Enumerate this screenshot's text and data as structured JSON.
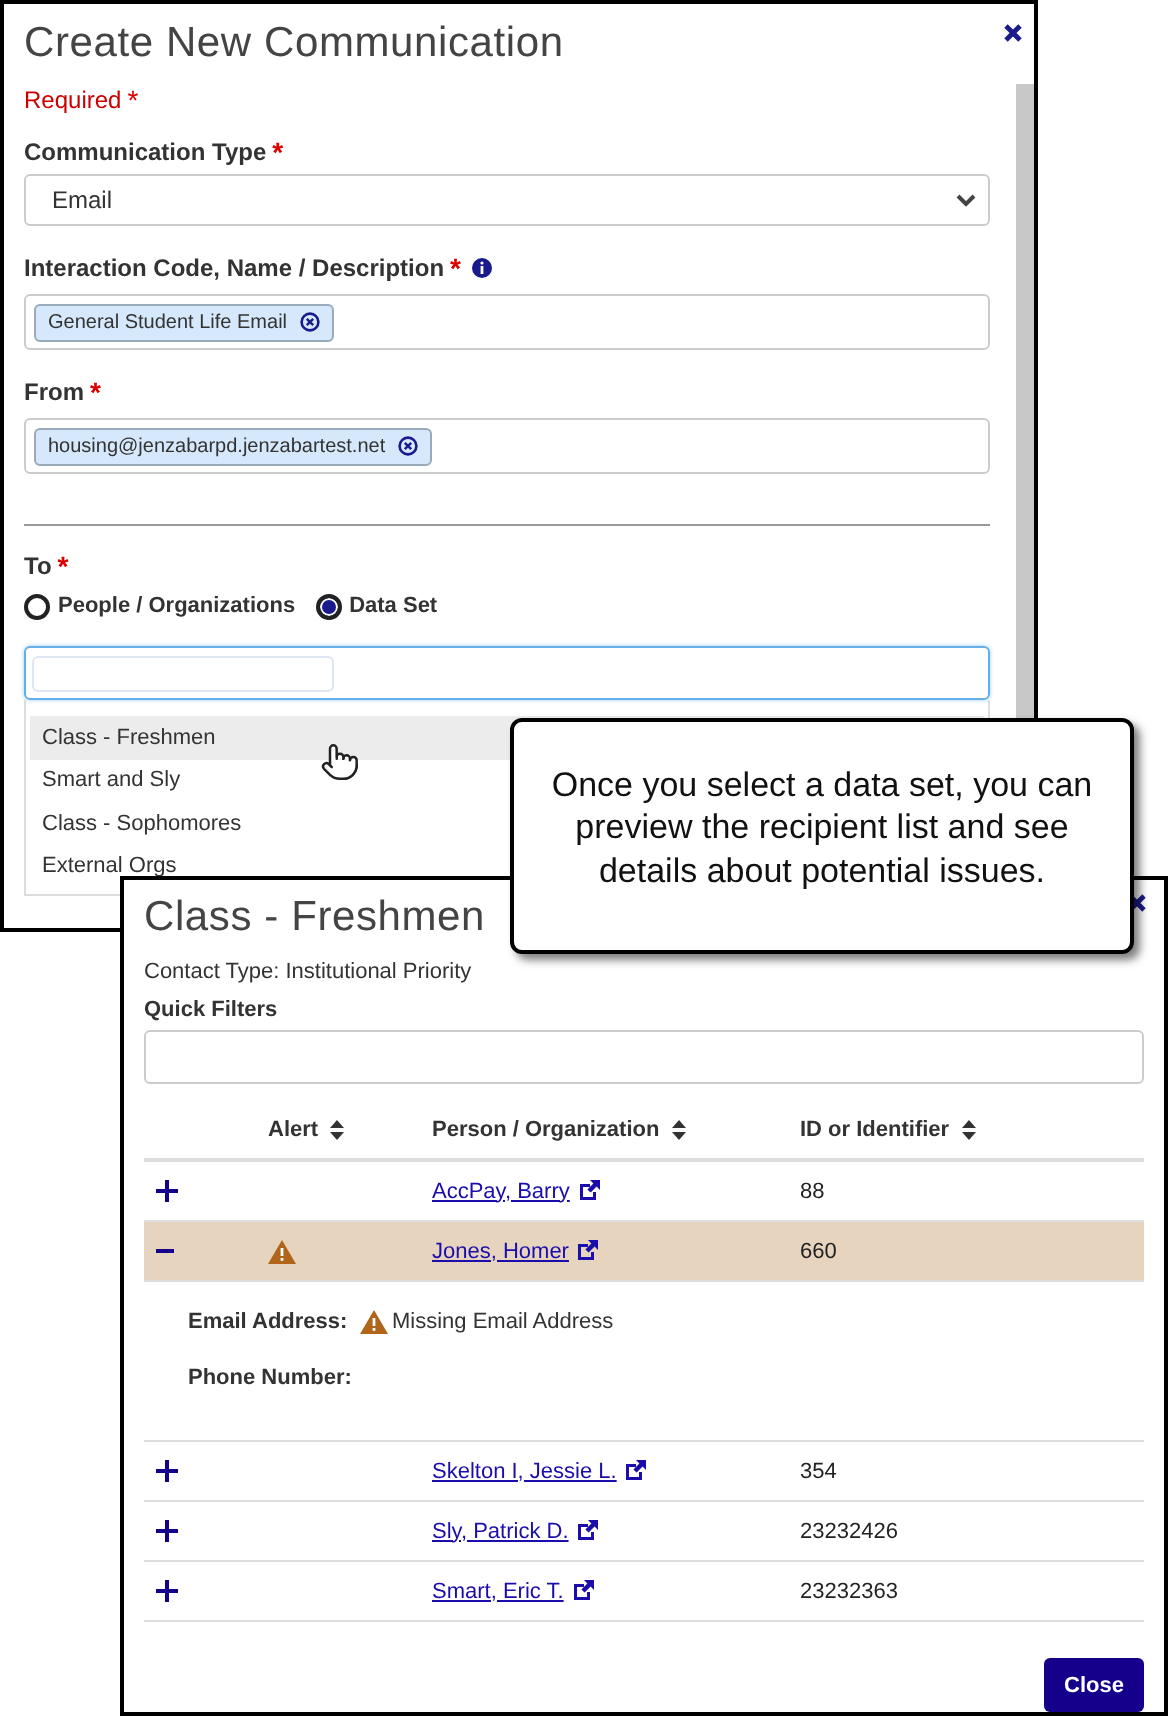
{
  "create_dialog": {
    "title": "Create New Communication",
    "required_note": "Required",
    "required_mark": "*",
    "fields": [
      {
        "kind": "select",
        "label": "Communication Type",
        "required": true,
        "info": false,
        "value": "Email"
      },
      {
        "kind": "chips",
        "label": "Interaction Code, Name / Description",
        "required": true,
        "info": true,
        "chips": [
          "General Student Life Email"
        ]
      },
      {
        "kind": "chips",
        "label": "From",
        "required": true,
        "info": false,
        "chips": [
          "housing@jenzabarpd.jenzabartest.net"
        ]
      }
    ],
    "to": {
      "label": "To",
      "required": true,
      "options": [
        {
          "label": "People / Organizations",
          "selected": false
        },
        {
          "label": "Data Set",
          "selected": true
        }
      ],
      "suggestions": [
        {
          "label": "Class - Freshmen",
          "selected": true
        },
        {
          "label": "Smart and Sly",
          "selected": false
        },
        {
          "label": "Class - Sophomores",
          "selected": false
        },
        {
          "label": "External Orgs",
          "selected": false
        }
      ]
    }
  },
  "callout": {
    "text": "Once you select a data set, you can preview the recipient list and see details about potential issues."
  },
  "data_set_dialog": {
    "title": "Class - Freshmen",
    "contact_type": "Contact Type: Institutional Priority",
    "quick_filters_label": "Quick Filters",
    "columns": [
      {
        "label": "Alert"
      },
      {
        "label": "Person / Organization"
      },
      {
        "label": "ID or Identifier"
      }
    ],
    "rows": [
      {
        "name": "AccPay, Barry",
        "id": "88",
        "expanded": false,
        "alert": false
      },
      {
        "name": "Jones, Homer",
        "id": "660",
        "expanded": true,
        "alert": true,
        "details": [
          {
            "label": "Email Address:",
            "value": "Missing Email Address",
            "alert": true
          },
          {
            "label": "Phone Number:",
            "alert": false
          }
        ]
      },
      {
        "name": "Skelton I, Jessie L.",
        "id": "354",
        "expanded": false,
        "alert": false
      },
      {
        "name": "Sly, Patrick D.",
        "id": "23232426",
        "expanded": false,
        "alert": false
      },
      {
        "name": "Smart, Eric T.",
        "id": "23232363",
        "expanded": false,
        "alert": false
      }
    ],
    "close_button": "Close"
  }
}
